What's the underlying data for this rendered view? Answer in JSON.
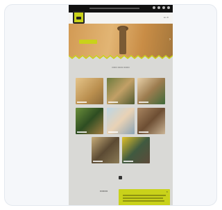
{
  "colors": {
    "accent": "#c9d21a",
    "topbar": "#111111",
    "page_bg": "#d9d9d6",
    "card_bg": "#f5f7fa"
  },
  "icons": [
    "logo-icon",
    "hero-next-arrow-icon",
    "close-icon"
  ]
}
